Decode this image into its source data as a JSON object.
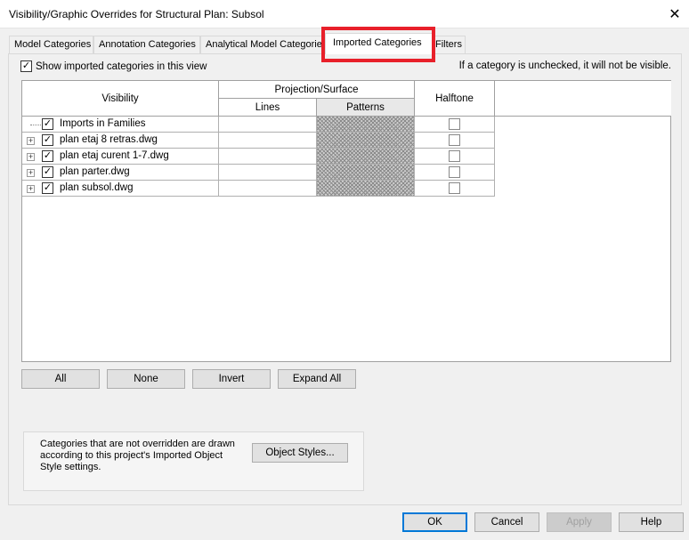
{
  "window": {
    "title": "Visibility/Graphic Overrides for Structural Plan: Subsol",
    "close_glyph": "✕"
  },
  "tabs": [
    {
      "label": "Model Categories"
    },
    {
      "label": "Annotation Categories"
    },
    {
      "label": "Analytical Model Categories"
    },
    {
      "label": "Imported Categories"
    },
    {
      "label": "Filters"
    }
  ],
  "active_tab": "Imported Categories",
  "show_imported": {
    "label": "Show imported categories in this view",
    "checked": true
  },
  "hint": "If a category is unchecked, it will not be visible.",
  "table": {
    "headers": {
      "visibility": "Visibility",
      "projection_surface": "Projection/Surface",
      "lines": "Lines",
      "patterns": "Patterns",
      "halftone": "Halftone"
    },
    "rows": [
      {
        "name": "Imports in Families",
        "visible": true,
        "expandable": false,
        "halftone": false
      },
      {
        "name": "plan etaj 8 retras.dwg",
        "visible": true,
        "expandable": true,
        "halftone": false
      },
      {
        "name": "plan etaj curent 1-7.dwg",
        "visible": true,
        "expandable": true,
        "halftone": false
      },
      {
        "name": "plan parter.dwg",
        "visible": true,
        "expandable": true,
        "halftone": false
      },
      {
        "name": "plan subsol.dwg",
        "visible": true,
        "expandable": true,
        "halftone": false
      }
    ]
  },
  "buttons": {
    "all": "All",
    "none": "None",
    "invert": "Invert",
    "expand_all": "Expand All",
    "object_styles": "Object Styles...",
    "ok": "OK",
    "cancel": "Cancel",
    "apply": "Apply",
    "help": "Help"
  },
  "info_text": "Categories that are not overridden are drawn according to this project's Imported Object Style settings.",
  "colors": {
    "highlight": "#e8202a",
    "primary_border": "#0078d7"
  },
  "icons": {
    "check": "✓",
    "expand": "+"
  }
}
